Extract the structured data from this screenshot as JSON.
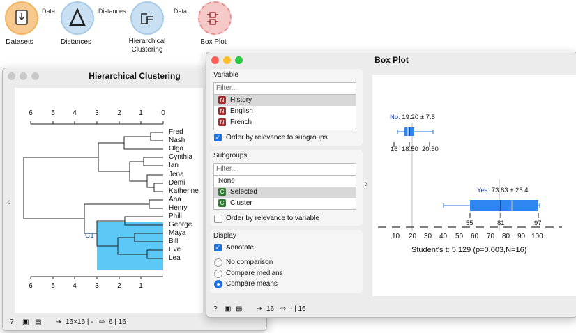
{
  "workflow": {
    "nodes": [
      {
        "id": "datasets",
        "label": "Datasets",
        "icon": "file-icon"
      },
      {
        "id": "distances",
        "label": "Distances",
        "icon": "triangle-icon"
      },
      {
        "id": "hierarchical",
        "label": "Hierarchical\nClustering",
        "icon": "dendrogram-icon"
      },
      {
        "id": "boxplot",
        "label": "Box Plot",
        "icon": "boxplot-icon"
      }
    ],
    "links": [
      "Data",
      "Distances",
      "Data"
    ]
  },
  "hc_window": {
    "title": "Hierarchical Clustering",
    "axis_ticks": [
      "6",
      "5",
      "4",
      "3",
      "2",
      "1",
      "0"
    ],
    "bottom_ticks": [
      "6",
      "5",
      "4",
      "3",
      "2",
      "1"
    ],
    "leaves": [
      "Fred",
      "Nash",
      "Olga",
      "Cynthia",
      "Ian",
      "Jena",
      "Demi",
      "Katherine",
      "Ana",
      "Henry",
      "Phill",
      "George",
      "Maya",
      "Bill",
      "Eve",
      "Lea"
    ],
    "cluster_label": "C1",
    "status": {
      "input": "16×16 | -",
      "output": "6 | 16"
    },
    "colors": {
      "selection": "#5bc8f5"
    }
  },
  "bp_window": {
    "title": "Box Plot",
    "variable": {
      "section": "Variable",
      "filter_placeholder": "Filter...",
      "items": [
        {
          "badge": "N",
          "label": "History",
          "selected": true
        },
        {
          "badge": "N",
          "label": "English",
          "selected": false
        },
        {
          "badge": "N",
          "label": "French",
          "selected": false
        }
      ],
      "order_label": "Order by relevance to subgroups",
      "order_checked": true
    },
    "subgroups": {
      "section": "Subgroups",
      "filter_placeholder": "Filter...",
      "items": [
        {
          "badge": "",
          "label": "None",
          "selected": false
        },
        {
          "badge": "C",
          "label": "Selected",
          "selected": true
        },
        {
          "badge": "C",
          "label": "Cluster",
          "selected": false
        }
      ],
      "order_label": "Order by relevance to variable",
      "order_checked": false
    },
    "display": {
      "section": "Display",
      "annotate_label": "Annotate",
      "annotate_checked": true,
      "options": [
        "No comparison",
        "Compare medians",
        "Compare means"
      ],
      "selected_option": 2
    },
    "plot": {
      "no_label_prefix": "No:",
      "no_label_stats": " 19.20 ± 7.5",
      "no_q1": "16",
      "no_median": "18.50",
      "no_q3": "20.50",
      "yes_label_prefix": "Yes:",
      "yes_label_stats": " 73.83 ± 25.4",
      "yes_q1": "55",
      "yes_median": "81",
      "yes_q3": "97",
      "axis_ticks": [
        "10",
        "20",
        "30",
        "40",
        "50",
        "60",
        "70",
        "80",
        "90",
        "100"
      ],
      "stat_text": "Student's t: 5.129 (p=0.003,N=16)"
    },
    "status": {
      "input": "16",
      "output": "- | 16"
    }
  },
  "chart_data": {
    "type": "box",
    "variable": "History",
    "groups": [
      {
        "name": "No",
        "mean": 19.2,
        "sd": 7.5,
        "q1": 16,
        "median": 18.5,
        "q3": 20.5
      },
      {
        "name": "Yes",
        "mean": 73.83,
        "sd": 25.4,
        "q1": 55,
        "median": 81,
        "q3": 97
      }
    ],
    "xlim": [
      10,
      100
    ],
    "test": "Student's t: 5.129 (p=0.003,N=16)"
  }
}
